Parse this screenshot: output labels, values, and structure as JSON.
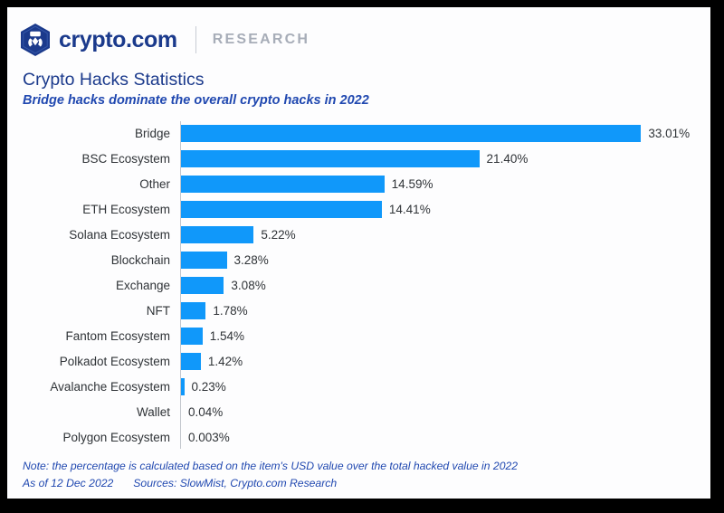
{
  "brand": {
    "logo_icon": "crypto-com-hexagon-logo",
    "name": "crypto.com",
    "section": "RESEARCH"
  },
  "title": "Crypto Hacks Statistics",
  "subtitle": "Bridge hacks dominate the overall crypto hacks in 2022",
  "colors": {
    "bar": "#1098fa",
    "brand_navy": "#1b3a8c",
    "accent_blue": "#2048b0",
    "label_gray": "#2f3337",
    "research_gray": "#a7adb8",
    "axis_gray": "#c3c7cd",
    "frame_border": "#000000",
    "page_background": "#fdfdfe"
  },
  "footer": {
    "note": "Note: the percentage is calculated based on the item's USD value over the total hacked value in 2022",
    "as_of": "As of 12 Dec 2022",
    "sources": "Sources: SlowMist, Crypto.com Research"
  },
  "chart_data": {
    "type": "bar",
    "orientation": "horizontal",
    "title": "Crypto Hacks Statistics",
    "subtitle": "Bridge hacks dominate the overall crypto hacks in 2022",
    "xlabel": "",
    "ylabel": "",
    "xlim": [
      0,
      33.01
    ],
    "grid": false,
    "legend": false,
    "value_suffix": "%",
    "categories": [
      "Bridge",
      "BSC Ecosystem",
      "Other",
      "ETH Ecosystem",
      "Solana Ecosystem",
      "Blockchain",
      "Exchange",
      "NFT",
      "Fantom Ecosystem",
      "Polkadot Ecosystem",
      "Avalanche Ecosystem",
      "Wallet",
      "Polygon Ecosystem"
    ],
    "values": [
      33.01,
      21.4,
      14.59,
      14.41,
      5.22,
      3.28,
      3.08,
      1.78,
      1.54,
      1.42,
      0.23,
      0.04,
      0.003
    ],
    "labels": [
      "33.01%",
      "21.40%",
      "14.59%",
      "14.41%",
      "5.22%",
      "3.28%",
      "3.08%",
      "1.78%",
      "1.54%",
      "1.42%",
      "0.23%",
      "0.04%",
      "0.003%"
    ]
  }
}
